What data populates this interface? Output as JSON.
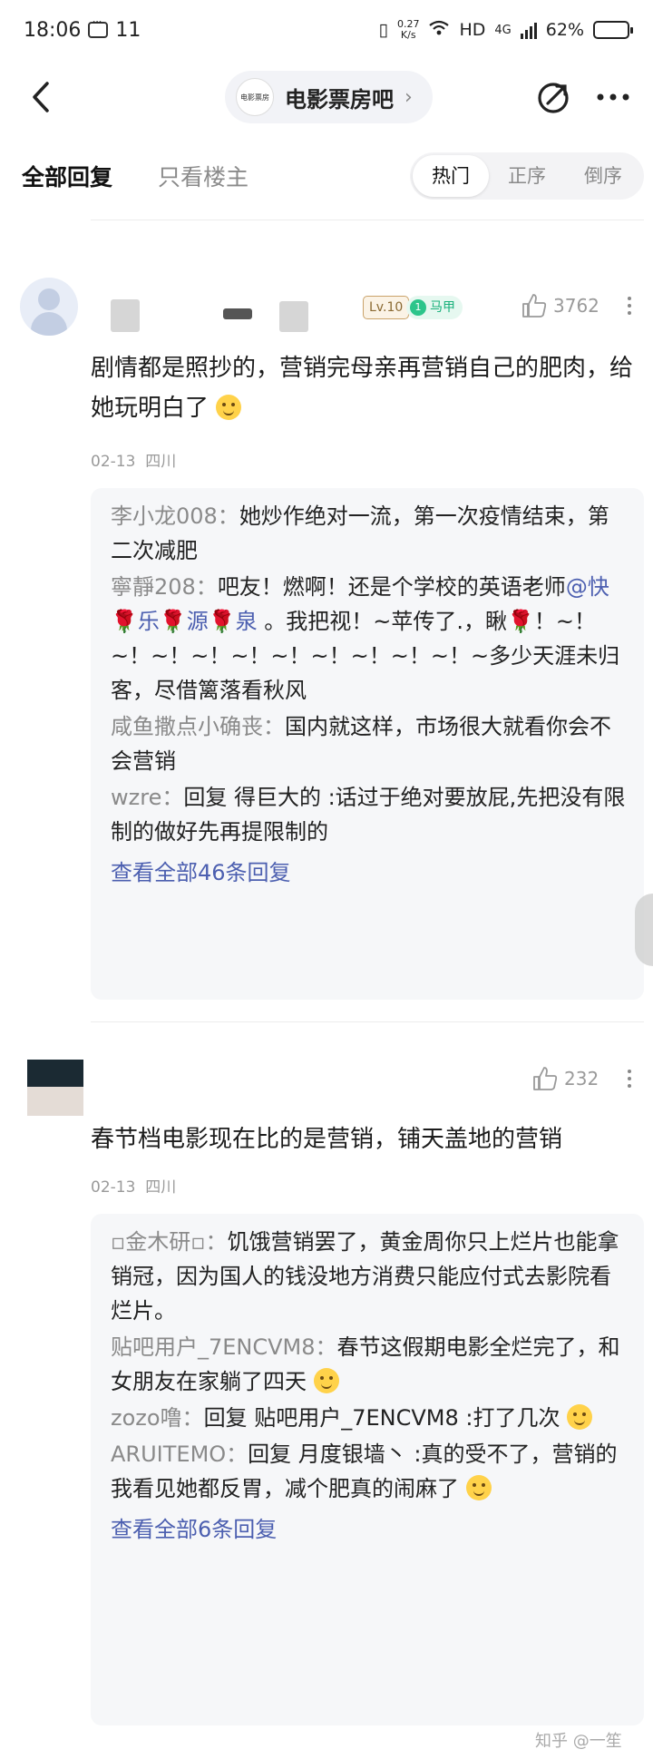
{
  "status_bar": {
    "time": "18:06",
    "notif_count": "11",
    "net_speed_value": "0.27",
    "net_speed_unit": "K/s",
    "network": "HD",
    "network_gen": "4G",
    "battery": "62%",
    "battery_level": 0.62
  },
  "nav": {
    "forum_name": "电影票房吧",
    "forum_chevron": "›",
    "forum_logo_text": "电影票房"
  },
  "filter": {
    "tab_all": "全部回复",
    "tab_op_only": "只看楼主",
    "sort_hot": "热门",
    "sort_asc": "正序",
    "sort_desc": "倒序"
  },
  "comments": [
    {
      "level_badge": "Lv.10",
      "vest_badge": "马甲",
      "vest_number": "1",
      "likes": "3762",
      "text": "剧情都是照抄的，营销完母亲再营销自己的肥肉，给她玩明白了",
      "date": "02-13",
      "location": "四川",
      "replies": [
        {
          "user": "李小龙008：",
          "text": "她炒作绝对一流，第一次疫情结束，第二次减肥"
        },
        {
          "user": "寧靜208：",
          "text_a": "吧友！燃啊！还是个学校的英语老师",
          "mention": "@快🌹乐🌹源🌹泉",
          "text_b": " 。我把视！~苹传了.，瞅🌹！~！~！~！~！~！~！~！~！~！~！~多少天涯未归客，尽借篱落看秋风"
        },
        {
          "user": "咸鱼撒点小确丧：",
          "text": "国内就这样，市场很大就看你会不会营销"
        },
        {
          "user": "wzre：",
          "text": "回复 得巨大的 :话过于绝对要放屁,先把没有限制的做好先再提限制的"
        }
      ],
      "view_all": "查看全部46条回复"
    },
    {
      "likes": "232",
      "text": "春节档电影现在比的是营销，铺天盖地的营销",
      "date": "02-13",
      "location": "四川",
      "replies": [
        {
          "user": "▫金木研▫：",
          "text": "饥饿营销罢了，黄金周你只上烂片也能拿销冠，因为国人的钱没地方消费只能应付式去影院看烂片。"
        },
        {
          "user": "贴吧用户_7ENCVM8：",
          "text": "春节这假期电影全烂完了，和女朋友在家躺了四天"
        },
        {
          "user": "zozo噜：",
          "text": "回复 贴吧用户_7ENCVM8 :打了几次"
        },
        {
          "user": "ARUITEMO：",
          "text": "回复 月度银墙丶 :真的受不了，营销的我看见她都反胃，减个肥真的闹麻了"
        }
      ],
      "view_all": "查看全部6条回复"
    }
  ],
  "watermark": "知乎 @一笙",
  "colors": {
    "link": "#4c5fb0",
    "badge_green": "#18b07a",
    "muted": "#9a9a9a"
  }
}
